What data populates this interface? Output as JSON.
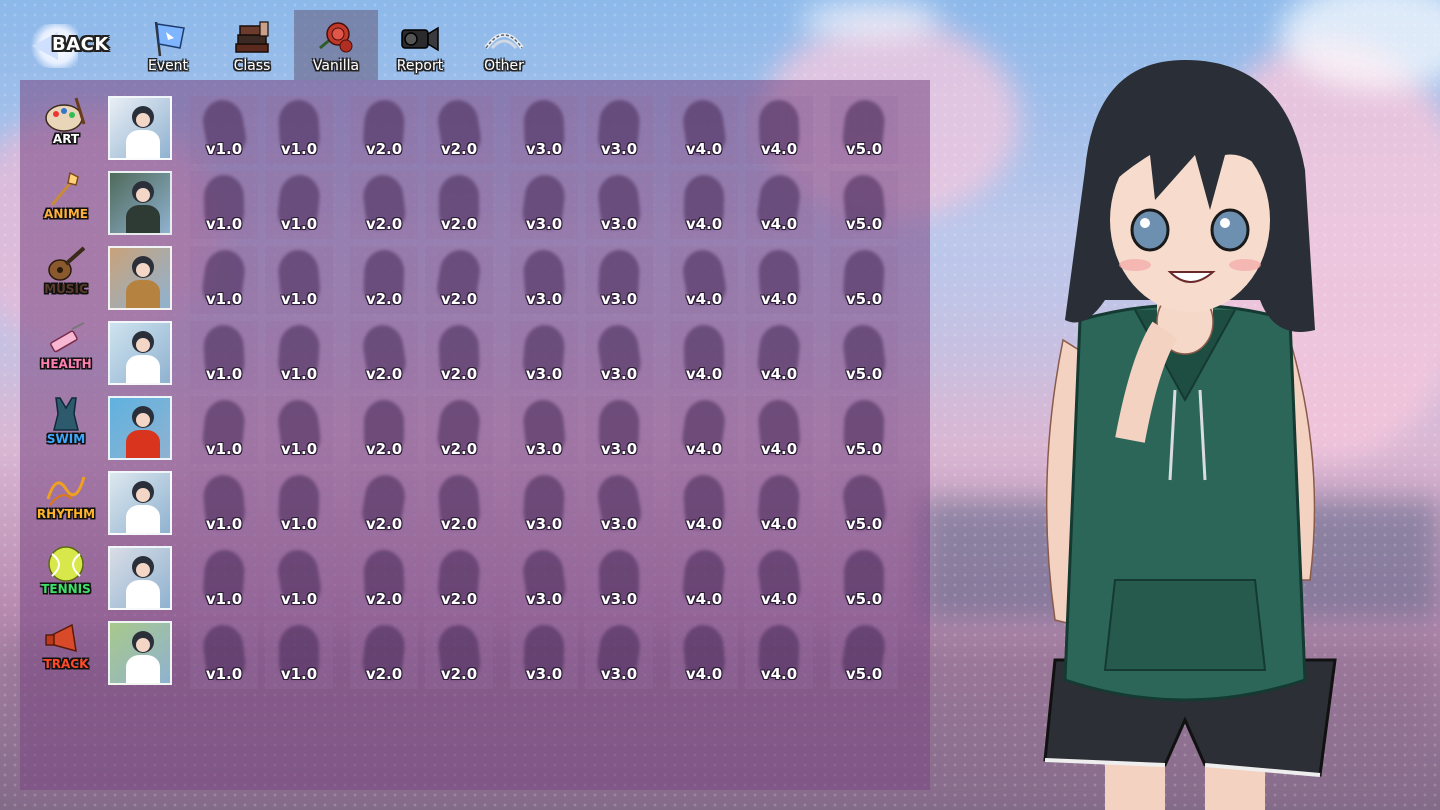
{
  "nav": {
    "back_label": "BACK",
    "tabs": [
      {
        "label": "Event",
        "icon": "flag-icon",
        "active": false
      },
      {
        "label": "Class",
        "icon": "books-icon",
        "active": false
      },
      {
        "label": "Vanilla",
        "icon": "rose-icon",
        "active": true
      },
      {
        "label": "Report",
        "icon": "camcorder-icon",
        "active": false
      },
      {
        "label": "Other",
        "icon": "lace-icon",
        "active": false
      }
    ]
  },
  "categories": [
    {
      "label": "ART",
      "icon": "palette-icon",
      "color": "#ffffff"
    },
    {
      "label": "ANIME",
      "icon": "magic-wand-icon",
      "color": "#ffb13b"
    },
    {
      "label": "MUSIC",
      "icon": "guitar-icon",
      "color": "#5a3a2a"
    },
    {
      "label": "HEALTH",
      "icon": "syringe-icon",
      "color": "#ff7fb0"
    },
    {
      "label": "SWIM",
      "icon": "swimsuit-icon",
      "color": "#3fa9ff"
    },
    {
      "label": "RHYTHM",
      "icon": "ribbon-icon",
      "color": "#ffb42a"
    },
    {
      "label": "TENNIS",
      "icon": "tennis-ball-icon",
      "color": "#3fe06a"
    },
    {
      "label": "TRACK",
      "icon": "megaphone-icon",
      "color": "#ff4a2a"
    }
  ],
  "versions": [
    "v1.0",
    "v1.0",
    "v2.0",
    "v2.0",
    "v3.0",
    "v3.0",
    "v4.0",
    "v4.0",
    "v5.0"
  ]
}
